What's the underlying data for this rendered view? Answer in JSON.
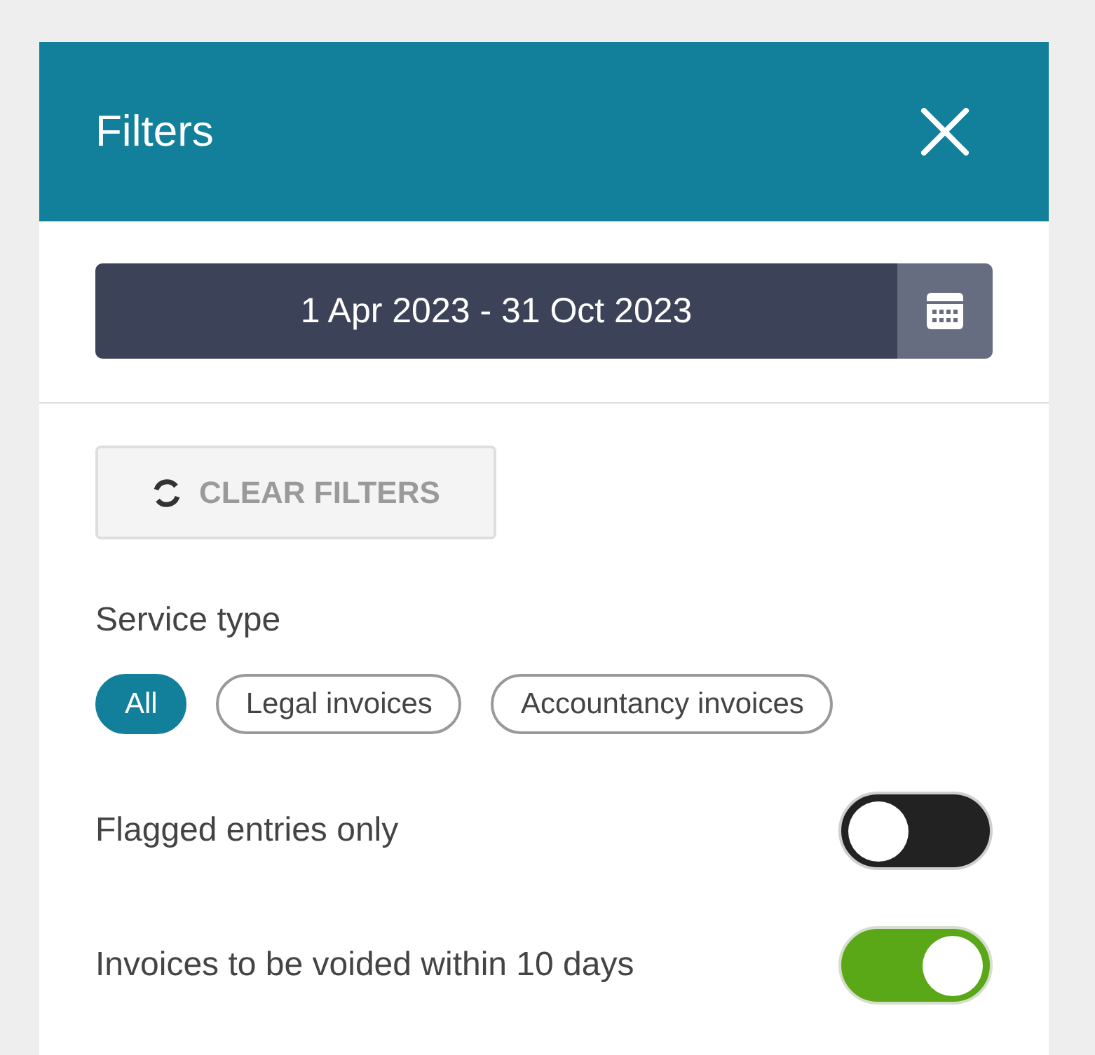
{
  "header": {
    "title": "Filters"
  },
  "date_range": {
    "value": "1 Apr 2023 - 31 Oct 2023"
  },
  "clear_button": {
    "label": "CLEAR FILTERS",
    "disabled": true
  },
  "service_type": {
    "label": "Service type",
    "options": [
      {
        "label": "All",
        "selected": true
      },
      {
        "label": "Legal invoices",
        "selected": false
      },
      {
        "label": "Accountancy invoices",
        "selected": false
      }
    ]
  },
  "toggles": [
    {
      "label": "Flagged entries only",
      "on": false
    },
    {
      "label": "Invoices to be voided within 10 days",
      "on": true
    }
  ]
}
